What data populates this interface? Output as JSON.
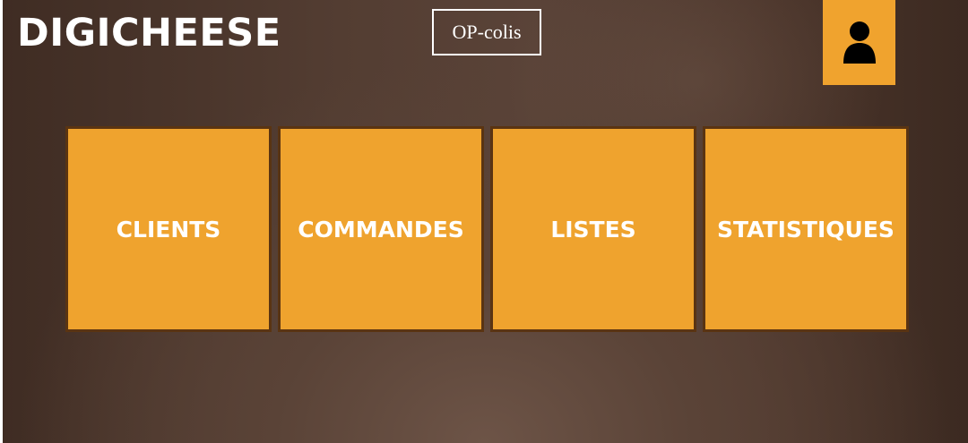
{
  "app": {
    "title": "DIGICHEESE"
  },
  "header": {
    "role_label": "OP-colis",
    "user_icon": "user-icon"
  },
  "menu": {
    "tiles": [
      {
        "label": "CLIENTS"
      },
      {
        "label": "COMMANDES"
      },
      {
        "label": "LISTES"
      },
      {
        "label": "STATISTIQUES"
      }
    ]
  },
  "colors": {
    "accent": "#efa32e",
    "tile_border": "#5a3412",
    "background": "#4b372d",
    "text": "#ffffff"
  }
}
